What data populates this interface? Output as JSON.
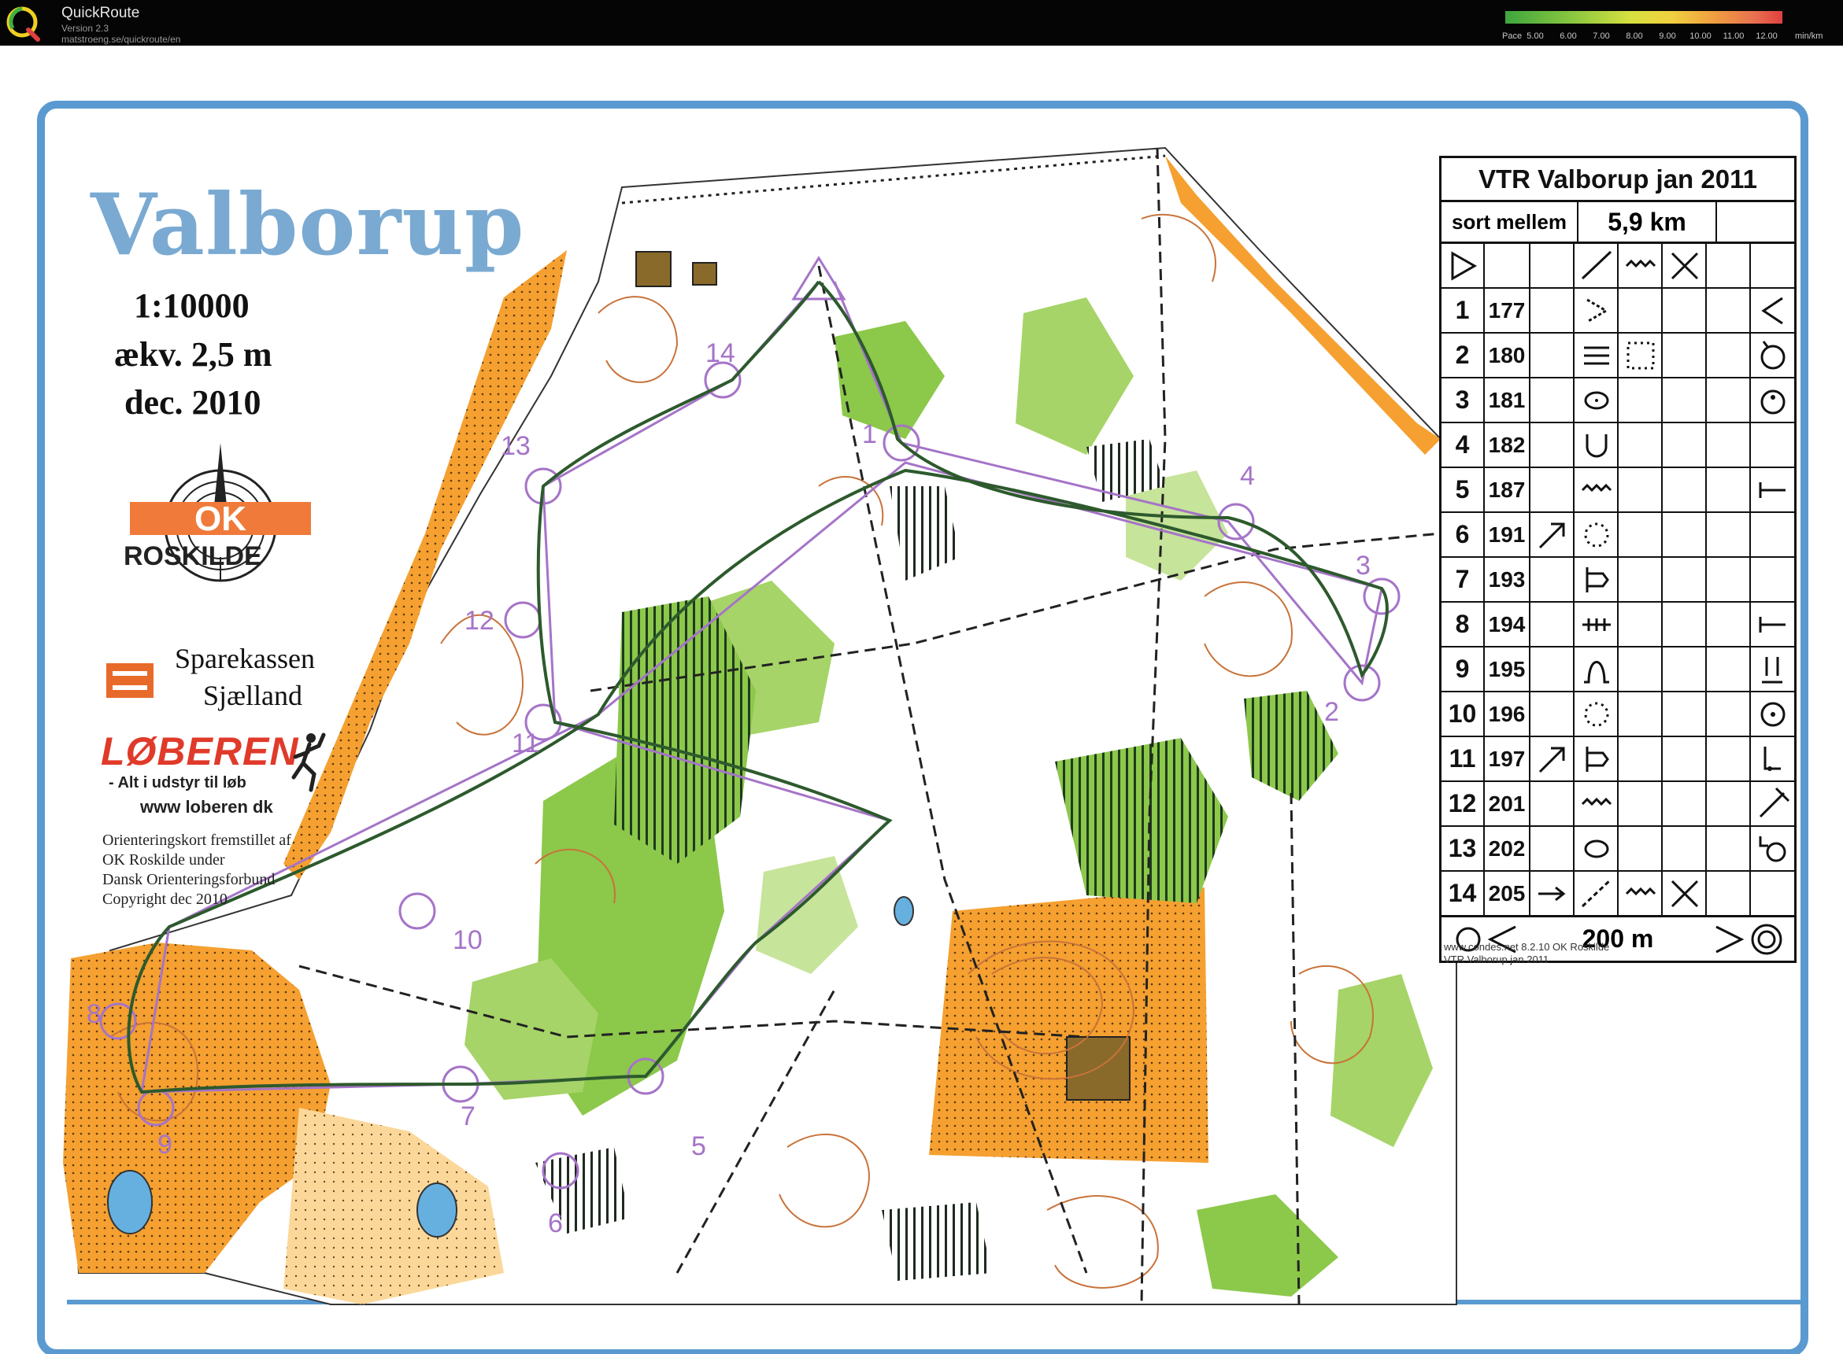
{
  "app": {
    "name": "QuickRoute",
    "version": "Version 2.3",
    "url": "matstroeng.se/quickroute/en"
  },
  "pace_legend": {
    "label": "Pace",
    "ticks": [
      "5.00",
      "6.00",
      "7.00",
      "8.00",
      "9.00",
      "10.00",
      "11.00",
      "12.00"
    ],
    "unit": "min/km",
    "colors": [
      "#3ea63e",
      "#8cc840",
      "#d6e040",
      "#f0d040",
      "#f0a040",
      "#e87050",
      "#e04040"
    ]
  },
  "map": {
    "title": "Valborup",
    "scale": "1:10000",
    "equidistance": "ækv. 2,5 m",
    "date": "dec. 2010",
    "club": "ROSKILDE",
    "club_logo_text": "OK",
    "sponsor_line1": "Sparekassen",
    "sponsor_line2": "Sjælland",
    "shop_name": "LØBEREN",
    "shop_tagline": "- Alt i udstyr til løb",
    "shop_url": "www loberen dk",
    "credits": [
      "Orienteringskort fremstillet af",
      "OK Roskilde under",
      "Dansk Orienteringsforbund",
      "Copyright dec 2010"
    ],
    "footer_software": "www.condes.net 8.2.10 OK Roskilde",
    "footer_event": "VTR Valborup jan 2011",
    "colors": {
      "border_blue": "#5a9ad0",
      "forest_green": "#8cc84a",
      "open_orange": "#f5a030",
      "contour_brown": "#c8733a",
      "course_purple": "#a574c8",
      "route_green": "#2d5a2d"
    }
  },
  "control_description": {
    "title": "VTR Valborup jan 2011",
    "course": "sort mellem",
    "length": "5,9 km",
    "controls": [
      {
        "num": "1",
        "code": "177"
      },
      {
        "num": "2",
        "code": "180"
      },
      {
        "num": "3",
        "code": "181"
      },
      {
        "num": "4",
        "code": "182"
      },
      {
        "num": "5",
        "code": "187"
      },
      {
        "num": "6",
        "code": "191"
      },
      {
        "num": "7",
        "code": "193"
      },
      {
        "num": "8",
        "code": "194"
      },
      {
        "num": "9",
        "code": "195"
      },
      {
        "num": "10",
        "code": "196"
      },
      {
        "num": "11",
        "code": "197"
      },
      {
        "num": "12",
        "code": "201"
      },
      {
        "num": "13",
        "code": "202"
      },
      {
        "num": "14",
        "code": "205"
      }
    ],
    "finish_distance": "200 m"
  },
  "control_labels": [
    "1",
    "2",
    "3",
    "4",
    "5",
    "6",
    "7",
    "8",
    "9",
    "10",
    "11",
    "12",
    "13",
    "14"
  ]
}
